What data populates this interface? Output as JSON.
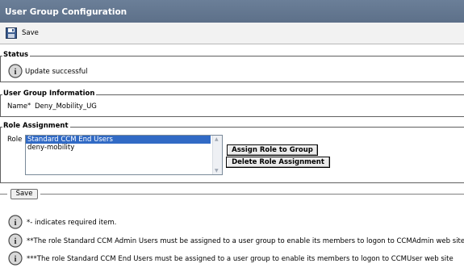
{
  "window": {
    "title": "User Group Configuration"
  },
  "toolbar": {
    "save_label": "Save"
  },
  "status": {
    "legend": "Status",
    "message": "Update successful"
  },
  "user_group_info": {
    "legend": "User Group Information",
    "name_label": "Name",
    "required_marker": "*",
    "name_value": "Deny_Mobility_UG"
  },
  "role_assignment": {
    "legend": "Role Assignment",
    "role_label": "Role",
    "roles": [
      "Standard CCM End Users",
      "deny-mobility"
    ],
    "selected_role": "Standard CCM End Users",
    "assign_button": "Assign Role to Group",
    "delete_button": "Delete Role Assignment"
  },
  "footer": {
    "save_label": "Save"
  },
  "notes": [
    {
      "marker": "*",
      "text": "- indicates required item."
    },
    {
      "marker": "**",
      "text": "The role Standard CCM Admin Users must be assigned to a user group to enable its members to logon to CCMAdmin web site"
    },
    {
      "marker": "***",
      "text": "The role Standard CCM End Users must be assigned to a user group to enable its members to logon to CCMUser web site"
    }
  ],
  "icons": {
    "save": "floppy-disk-icon",
    "info": "info-icon"
  },
  "colors": {
    "titlebar": "#5d7089",
    "selection": "#316ac5"
  }
}
